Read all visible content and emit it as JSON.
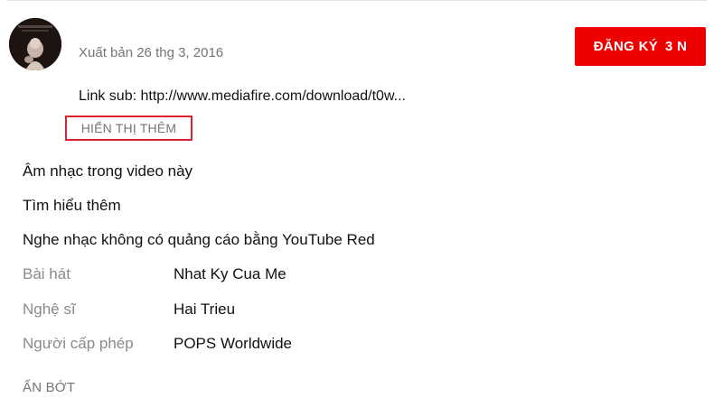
{
  "channel": {
    "published": "Xuất bản 26 thg 3, 2016",
    "subscribe_label": "ĐĂNG KÝ",
    "subscriber_count": "3 N"
  },
  "description": {
    "text": "Link sub: http://www.mediafire.com/download/t0w...",
    "show_more": "HIỂN THỊ THÊM"
  },
  "music_section": {
    "heading": "Âm nhạc trong video này",
    "learn_more": "Tìm hiểu thêm",
    "promo": "Nghe nhạc không có quảng cáo bằng YouTube Red",
    "rows": [
      {
        "label": "Bài hát",
        "value": "Nhat Ky Cua Me"
      },
      {
        "label": "Nghệ sĩ",
        "value": "Hai Trieu"
      },
      {
        "label": "Người cấp phép",
        "value": "POPS Worldwide"
      }
    ]
  },
  "show_less": "ẨN BỚT",
  "colors": {
    "subscribe_red": "#ee0000",
    "highlight_box": "#d9232d",
    "muted_text": "#757575"
  }
}
